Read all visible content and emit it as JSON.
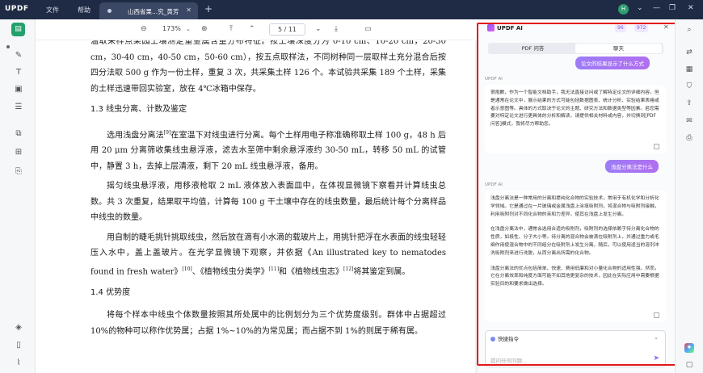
{
  "titlebar": {
    "logo": "UPDF",
    "menu_file": "文件",
    "menu_help": "帮助",
    "tab_title": "山西省果...究_黄芳",
    "avatar": "H"
  },
  "toolbar": {
    "zoom": "173%",
    "page_current": "5",
    "page_sep": "/",
    "page_total": "11"
  },
  "document": {
    "p0": "温取采样点果园土壤测定重金属含量分布特征。按土壤深度分为 0-10 cm、10-20 cm，20-30 cm，30-40 cm，40-50 cm，50-60 cm），按五点取样法，不同树种同一层取样土充分混合后按四分法取 500 g 作为一份土样，重复 3 次，共采集土样 126 个。本试验共采集 189 个土样，采集的土样迅速带回实验室，放在 4℃冰箱中保存。",
    "h1": "1.3 线虫分离、计数及鉴定",
    "p1a": "选用浅盘分离法",
    "p1ref": "[9]",
    "p1b": "在室温下对线虫进行分离。每个土样用电子称准确称取土样 100 g，48 h 后用 20 μm 分离筛收集线虫悬浮液，滤去水至筛中剩余悬浮液约 30-50 mL，转移 50 mL 的试管中，静置 3 h，去掉上层清液，剩下 20 mL 线虫悬浮液，备用。",
    "p2": "摇匀线虫悬浮液，用移液枪取 2 mL 液体放入表面皿中，在体视显微镜下察看并计算线虫总数。共 3 次重复，结果取平均值，计算每 100 g 干土壤中存在的线虫数量，最后统计每个分离样品中线虫的数量。",
    "p3a": "用自制的睫毛挑针挑取线虫，然后放在滴有小水滴的载玻片上，用挑针把浮在水表面的线虫轻轻压入水中，盖上盖玻片。在光学显微镜下观察，并依据《An illustrated key to nematodes found in fresh water》",
    "p3ref1": "[10]",
    "p3b": "、《植物线虫分类学》",
    "p3ref2": "[11]",
    "p3c": "和《植物线虫志》",
    "p3ref3": "[12]",
    "p3d": "将其鉴定到属。",
    "h2": "1.4 优势度",
    "p4": "将每个样本中线虫个体数量按照其所处属中的比例划分为三个优势度级别。群体中占据超过 10%的物种可以称作优势属；占据 1%~10%的为常见属；而占据不到 1%的则属于稀有属。"
  },
  "ai_panel": {
    "title": "UPDF AI",
    "badge1": "96",
    "badge2": "972",
    "tab_qa": "PDF 问答",
    "tab_chat": "聊天",
    "user_msg1": "论文的结果显示了什么方式",
    "label1": "UPDF AI",
    "reply1": "很抱歉，作为一个智能文档助手，我无法直接访问或了解特定论文的详细内容。但是通常在论文中，展示结果的方式可能包括数据图表、统计分析、实验结果表格或者示意图等。具体的方式取决于论文的主题、研究方法和数据类型等因素。若您需要对特定论文进行更具体的分析和解读，请提供相关材料或内容，并切换到[PDF问答]模式，我将尽力帮助您。",
    "user_msg2": "浅盘分离法是什么",
    "label2": "UPDF AI",
    "reply2_p1": "浅盘分离法是一种常用的分离和提纯化合物的实验技术，常用于有机化学和分析化学领域。它是通过在一片玻璃或金属浅盘上涂填吸附剂，将混合物与吸附剂接触，利用吸附剂对不同化合物的亲和力差异，使其在浅盘上发生分离。",
    "reply2_p2": "在浅盘分离法中，通常会选用合适的吸附剂，吸附剂的选择依赖于待分离化合物的性质，如极性、分子大小等。待分离的混合物会被滴在吸附剂上，并通过重力或毛细作用使混合物中的不同组分在吸附剂上发生分离。随后，可以使用适当的溶剂冲洗吸附剂来进行洗脱，从而分离出所需的化合物。",
    "reply2_p3": "浅盘分离法的优点包括简单、快速、费用低廉和对小量化合物的适用性强。然而，它在分离效率和纯度方面可能不如其他更复杂的技术，因此在实际应用中需要根据实验目的和要求做出选择。",
    "quick_cmd": "快捷指令",
    "input_placeholder": "提问任何问题..."
  }
}
